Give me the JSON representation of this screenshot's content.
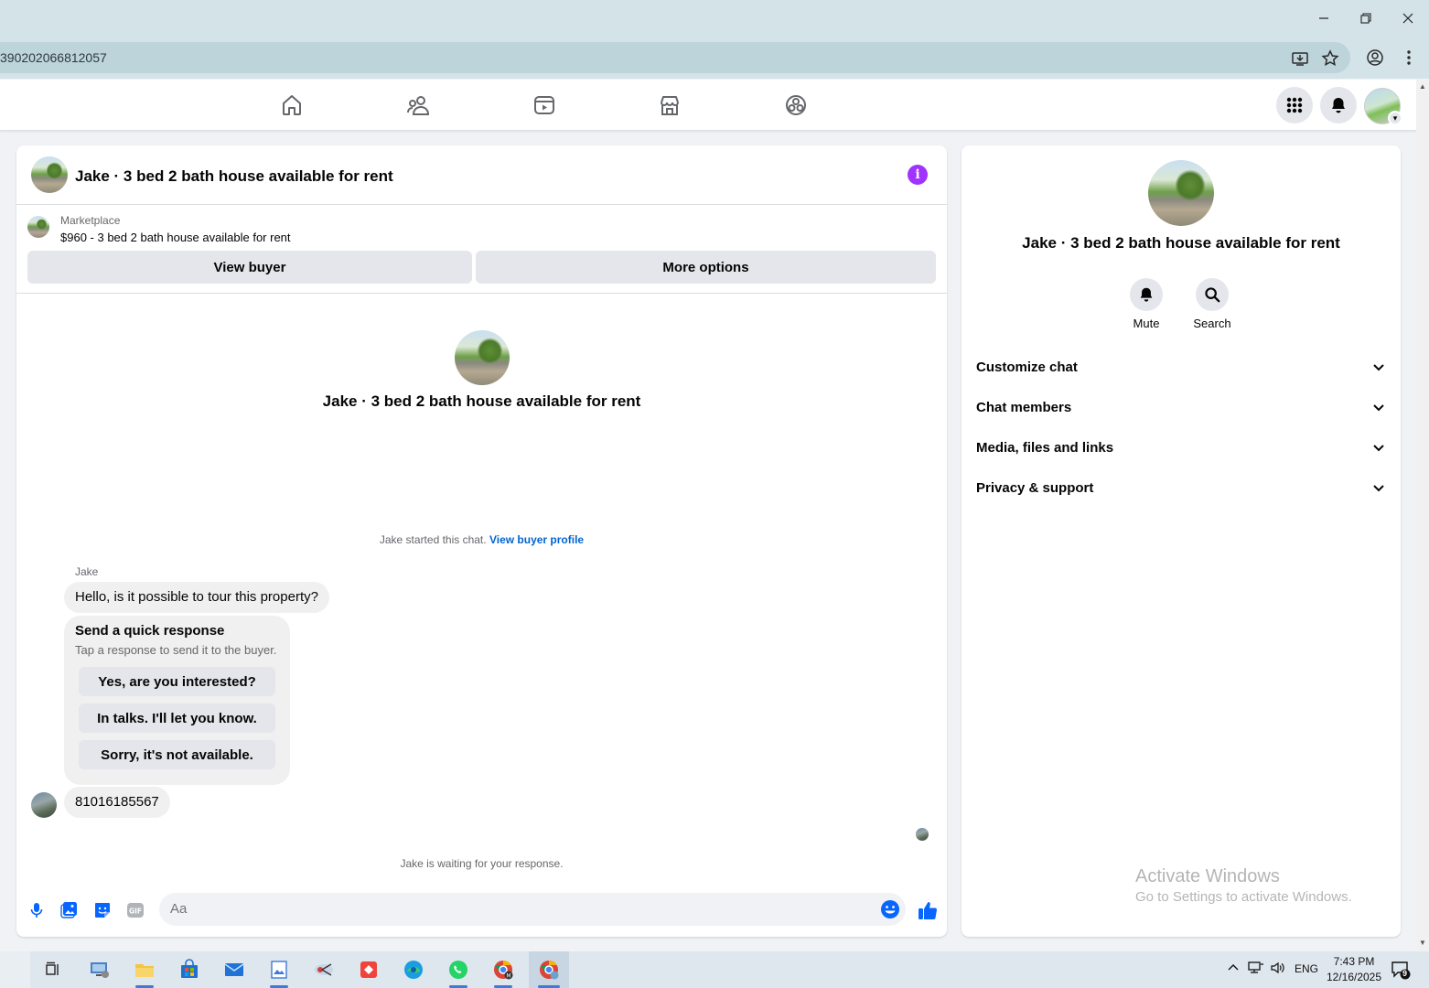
{
  "browser": {
    "url_fragment": "390202066812057"
  },
  "chat": {
    "title": "Jake · 3 bed 2 bath house available for rent",
    "marketplace_label": "Marketplace",
    "listing_price_title": "$960 - 3 bed 2 bath house available for rent",
    "view_buyer_label": "View buyer",
    "more_options_label": "More options",
    "intro_name": "Jake · 3 bed 2 bath house available for rent",
    "started_text": "Jake started this chat.",
    "view_buyer_profile_link": "View buyer profile",
    "sender_name": "Jake",
    "messages": [
      "Hello, is it possible to tour this property?",
      "81016185567"
    ],
    "quick_response": {
      "title": "Send a quick response",
      "subtitle": "Tap a response to send it to the buyer.",
      "options": [
        "Yes, are you interested?",
        "In talks. I'll let you know.",
        "Sorry, it's not available."
      ]
    },
    "waiting_text": "Jake is waiting for your response.",
    "composer_placeholder": "Aa"
  },
  "info_panel": {
    "name": "Jake · 3 bed 2 bath house available for rent",
    "actions": [
      "Mute",
      "Search"
    ],
    "sections": [
      "Customize chat",
      "Chat members",
      "Media, files and links",
      "Privacy & support"
    ]
  },
  "watermark": {
    "line1": "Activate Windows",
    "line2": "Go to Settings to activate Windows."
  },
  "taskbar": {
    "language": "ENG",
    "time": "7:43 PM",
    "date": "12/16/2025",
    "notification_count": "9"
  },
  "colors": {
    "accent_blue": "#0866ff",
    "info_purple": "#a033ff",
    "link_blue": "#0064d1"
  }
}
